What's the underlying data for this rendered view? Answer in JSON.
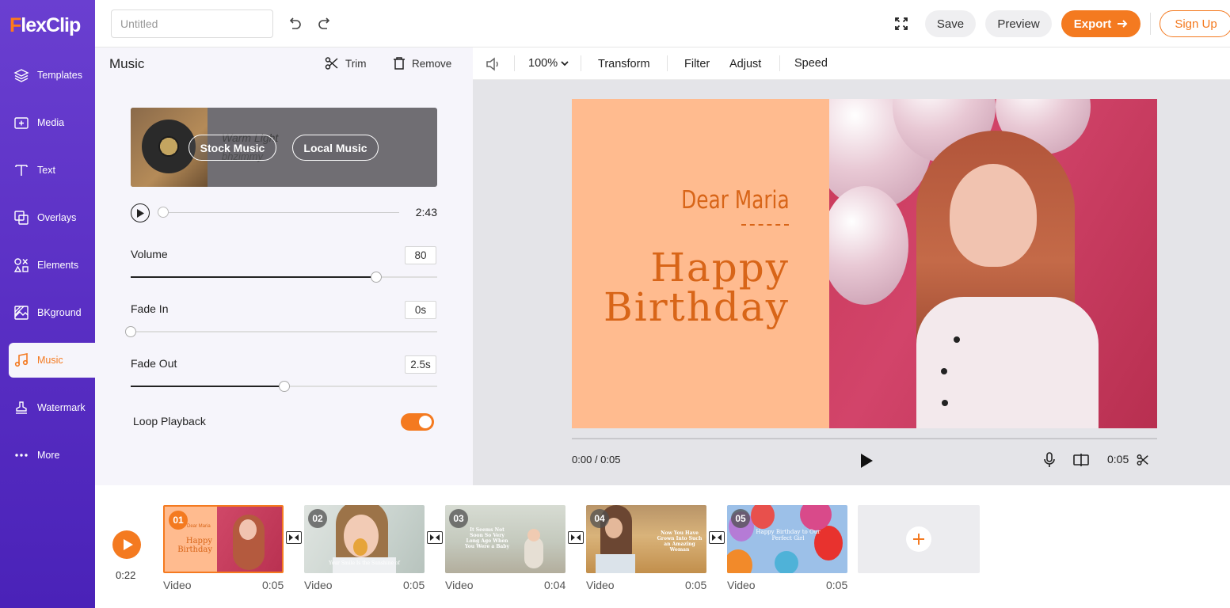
{
  "app": {
    "logo_f": "F",
    "logo_rest": "lexClip",
    "title_placeholder": "Untitled"
  },
  "topbar": {
    "save": "Save",
    "preview": "Preview",
    "export": "Export",
    "signup": "Sign Up"
  },
  "sidebar": {
    "items": [
      {
        "label": "Templates",
        "icon": "layers-icon"
      },
      {
        "label": "Media",
        "icon": "media-icon"
      },
      {
        "label": "Text",
        "icon": "text-icon"
      },
      {
        "label": "Overlays",
        "icon": "overlays-icon"
      },
      {
        "label": "Elements",
        "icon": "elements-icon"
      },
      {
        "label": "BKground",
        "icon": "background-icon"
      },
      {
        "label": "Music",
        "icon": "music-icon",
        "active": true
      },
      {
        "label": "Watermark",
        "icon": "stamp-icon"
      },
      {
        "label": "More",
        "icon": "more-icon"
      }
    ]
  },
  "music_panel": {
    "title": "Music",
    "trim": "Trim",
    "remove": "Remove",
    "track_name": "Warm Light",
    "track_artist": "bhzimmy",
    "stock_music": "Stock Music",
    "local_music": "Local Music",
    "duration": "2:43",
    "playback_progress": 0,
    "volume_label": "Volume",
    "volume_value": "80",
    "volume_fraction": 0.8,
    "fade_in_label": "Fade In",
    "fade_in_value": "0s",
    "fade_in_fraction": 0,
    "fade_out_label": "Fade Out",
    "fade_out_value": "2.5s",
    "fade_out_fraction": 0.5,
    "loop_label": "Loop Playback",
    "loop_on": true
  },
  "editor_toolbar": {
    "zoom": "100%",
    "transform": "Transform",
    "filter": "Filter",
    "adjust": "Adjust",
    "speed": "Speed"
  },
  "canvas": {
    "greeting": "Dear Maria",
    "headline_1": "Happy",
    "headline_2": "Birthday",
    "time": "0:00 / 0:05",
    "clip_duration": "0:05"
  },
  "timeline": {
    "total": "0:22",
    "clips": [
      {
        "num": "01",
        "type": "Video",
        "dur": "0:05",
        "active": true
      },
      {
        "num": "02",
        "type": "Video",
        "dur": "0:05"
      },
      {
        "num": "03",
        "type": "Video",
        "dur": "0:04"
      },
      {
        "num": "04",
        "type": "Video",
        "dur": "0:05"
      },
      {
        "num": "05",
        "type": "Video",
        "dur": "0:05"
      }
    ],
    "clip1_text": {
      "greeting": "Dear Maria",
      "line1": "Happy",
      "line2": "Birthday"
    },
    "clip2_text": "Your Smile Is the Sunshine of",
    "clip3_text": "It Seems Not Soon So Very Long Ago When You Were a Baby",
    "clip4_text": "Now You Have Grown Into Such an Amazing Woman",
    "clip5_text": "Happy Birthday to Our Perfect Girl"
  },
  "colors": {
    "accent": "#f47a20",
    "sidebar": "#5a2fc4",
    "canvas_left": "#ffbb8f",
    "headline": "#d86518"
  }
}
